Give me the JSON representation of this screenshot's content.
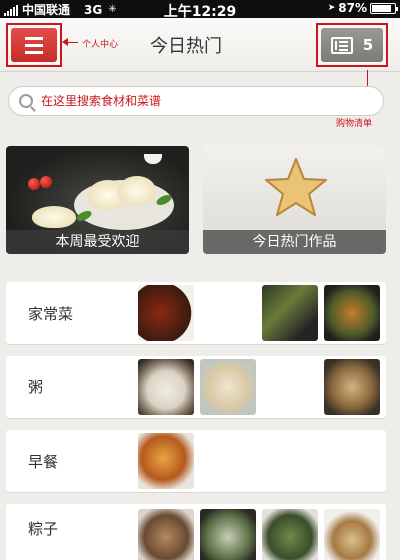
{
  "status_bar": {
    "carrier": "中国联通",
    "network": "3G",
    "time": "上午12:29",
    "battery_text": "87%",
    "battery_level": 0.87
  },
  "nav": {
    "title": "今日热门",
    "menu_annotation": "个人中心",
    "list_count": "5",
    "list_annotation": "购物清单"
  },
  "search": {
    "placeholder": "在这里搜索食材和菜谱"
  },
  "featured": [
    {
      "label": "本周最受欢迎"
    },
    {
      "label": "今日热门作品"
    }
  ],
  "categories": [
    {
      "label": "家常菜"
    },
    {
      "label": "粥"
    },
    {
      "label": "早餐"
    },
    {
      "label": "粽子"
    }
  ],
  "colors": {
    "accent_red": "#c8161d",
    "background": "#efedea"
  }
}
